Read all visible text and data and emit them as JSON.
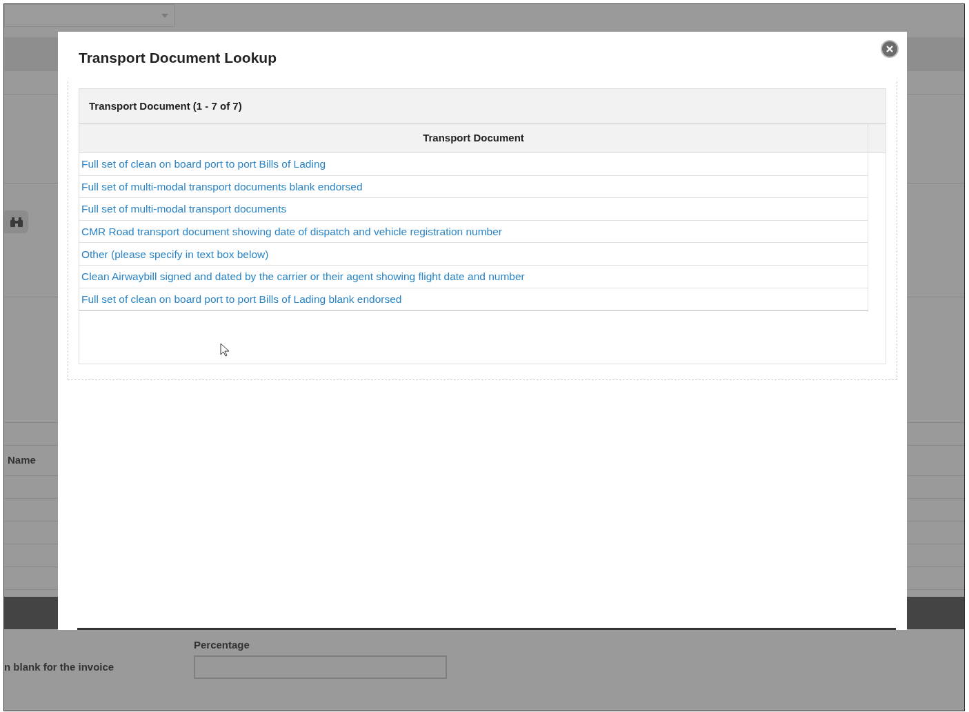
{
  "background": {
    "column_header": "Name",
    "note": "n blank for the invoice",
    "percentage_field": {
      "label": "Percentage"
    }
  },
  "dialog": {
    "title": "Transport Document Lookup",
    "grid": {
      "caption": "Transport Document (1 - 7 of 7)",
      "columns": [
        "Transport Document"
      ],
      "rows": [
        "Full set of clean on board port to port Bills of Lading",
        "Full set of multi-modal transport documents blank endorsed",
        "Full set of multi-modal transport documents",
        "CMR Road transport document showing date of dispatch and vehicle registration number",
        "Other (please specify in text box below)",
        "Clean Airwaybill signed and dated by the carrier or their agent showing flight date and number",
        "Full set of clean on board port to port Bills of Lading blank endorsed"
      ]
    }
  }
}
